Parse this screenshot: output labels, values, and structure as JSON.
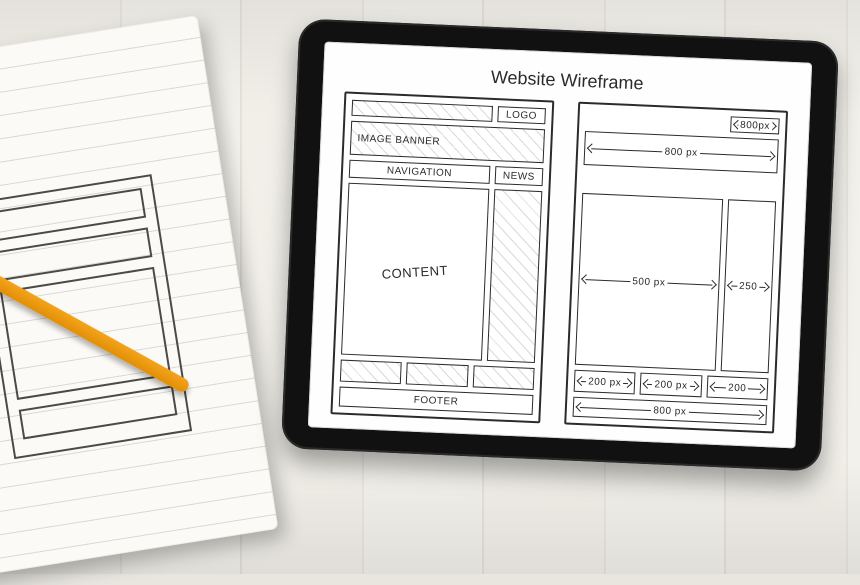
{
  "title": "Website Wireframe",
  "left_wireframe": {
    "logo": "LOGO",
    "banner": "IMAGE BANNER",
    "navigation": "NAVIGATION",
    "news": "NEWS",
    "content": "CONTENT",
    "footer": "FOOTER"
  },
  "right_wireframe": {
    "top_small": "800px",
    "width_full": "800 px",
    "width_main": "500 px",
    "width_side": "250",
    "col_a": "200 px",
    "col_b": "200 px",
    "col_c": "200",
    "bottom_full": "800 px"
  }
}
